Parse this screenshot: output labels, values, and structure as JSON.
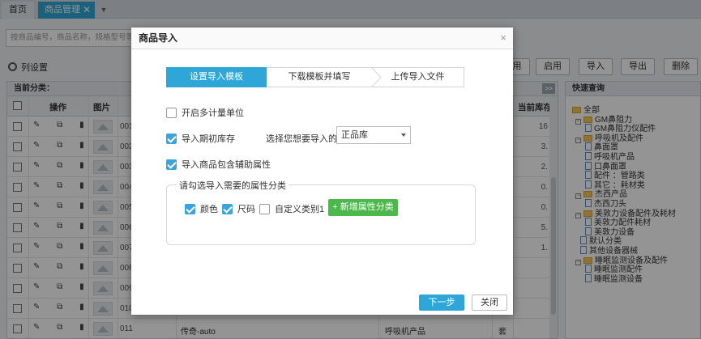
{
  "tabs": {
    "home": "首页",
    "goods": "商品管理",
    "close_glyph": "✕",
    "dropdown_glyph": "▼"
  },
  "search": {
    "placeholder": "按商品编号，商品名称，规格型号等查询"
  },
  "column_settings": "列设置",
  "toolbar": {
    "enable_partial": "用",
    "enable": "启用",
    "import": "导入",
    "export": "导出",
    "delete": "删除"
  },
  "grid": {
    "category_label": "当前分类：",
    "collapse_glyph": ">>",
    "headers": {
      "ops": "操作",
      "image": "图片",
      "stock": "当前库存"
    },
    "ops_glyphs": "✎ ⧉ ▮",
    "rows": [
      {
        "code": "001",
        "stock": "16",
        "name": "",
        "cat": "",
        "unit": ""
      },
      {
        "code": "002",
        "stock": "3.",
        "name": "",
        "cat": "",
        "unit": ""
      },
      {
        "code": "003",
        "stock": "2.",
        "name": "",
        "cat": "",
        "unit": ""
      },
      {
        "code": "004",
        "stock": "0.",
        "name": "",
        "cat": "",
        "unit": ""
      },
      {
        "code": "005",
        "stock": "0.",
        "name": "",
        "cat": "",
        "unit": ""
      },
      {
        "code": "006",
        "stock": "5.",
        "name": "",
        "cat": "",
        "unit": ""
      },
      {
        "code": "007",
        "stock": "1.",
        "name": "",
        "cat": "",
        "unit": ""
      },
      {
        "code": "008",
        "stock": "",
        "name": "",
        "cat": "",
        "unit": ""
      },
      {
        "code": "009",
        "stock": "",
        "name": "",
        "cat": "",
        "unit": ""
      },
      {
        "code": "010",
        "stock": "",
        "name": "",
        "cat": "",
        "unit": ""
      },
      {
        "code": "011",
        "stock": "",
        "name": "传奇-auto",
        "cat": "呼吸机产品",
        "unit": "套"
      }
    ]
  },
  "tree": {
    "title": "快速查询",
    "nodes": [
      {
        "label": "全部",
        "type": "folder",
        "pm": ""
      },
      {
        "label": "GM鼻阻力",
        "type": "folder",
        "pm": "−"
      },
      {
        "label": "GM鼻阻力仪配件",
        "type": "file",
        "pm": ""
      },
      {
        "label": "呼吸机及配件",
        "type": "folder",
        "pm": "−"
      },
      {
        "label": "鼻面罩",
        "type": "file",
        "pm": ""
      },
      {
        "label": "呼吸机产品",
        "type": "file",
        "pm": ""
      },
      {
        "label": "口鼻面罩",
        "type": "file",
        "pm": ""
      },
      {
        "label": "配件 ：管路类",
        "type": "file",
        "pm": ""
      },
      {
        "label": "其它 ：耗材类",
        "type": "file",
        "pm": ""
      },
      {
        "label": "杰西产品",
        "type": "folder",
        "pm": "−"
      },
      {
        "label": "杰西刀头",
        "type": "file",
        "pm": ""
      },
      {
        "label": "美敦力设备配件及耗材",
        "type": "folder",
        "pm": "−"
      },
      {
        "label": "美敦力配件耗材",
        "type": "file",
        "pm": ""
      },
      {
        "label": "美敦力设备",
        "type": "file",
        "pm": ""
      },
      {
        "label": "默认分类",
        "type": "file",
        "pm": ""
      },
      {
        "label": "其他设备器械",
        "type": "file",
        "pm": ""
      },
      {
        "label": "睡眠监测设备及配件",
        "type": "folder",
        "pm": "−"
      },
      {
        "label": "睡眠监测配件",
        "type": "file",
        "pm": ""
      },
      {
        "label": "睡眠监测设备",
        "type": "file",
        "pm": ""
      }
    ]
  },
  "dialog": {
    "title": "商品导入",
    "close_glyph": "×",
    "steps": [
      "设置导入模板",
      "下载模板并填写",
      "上传导入文件"
    ],
    "multi_unit": "开启多计量单位",
    "import_opening_stock": "导入期初库存",
    "warehouse_label": "选择您想要导入的仓库:",
    "warehouse_value": "正品库",
    "include_aux": "导入商品包含辅助属性",
    "attr_legend": "请勾选导入需要的属性分类",
    "attrs": {
      "color": "颜色",
      "size": "尺码",
      "custom": "自定义类别1"
    },
    "add_attr": "+ 新增属性分类",
    "next": "下一步",
    "close": "关闭"
  }
}
